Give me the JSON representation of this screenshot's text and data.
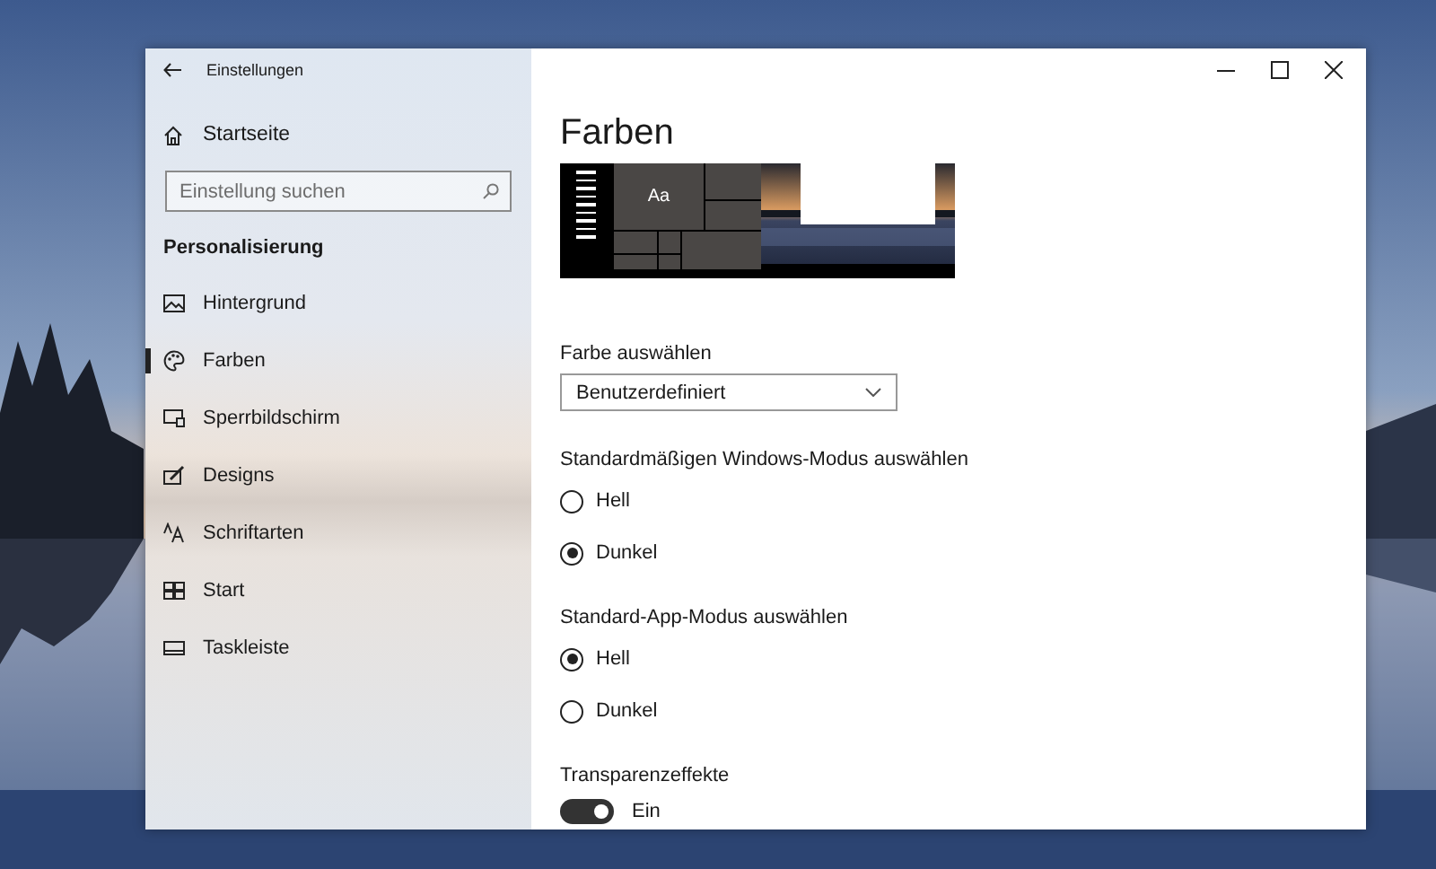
{
  "window": {
    "title": "Einstellungen"
  },
  "sidebar": {
    "home": "Startseite",
    "search": {
      "placeholder": "Einstellung suchen"
    },
    "section": "Personalisierung",
    "items": [
      {
        "label": "Hintergrund",
        "selected": false
      },
      {
        "label": "Farben",
        "selected": true
      },
      {
        "label": "Sperrbildschirm",
        "selected": false
      },
      {
        "label": "Designs",
        "selected": false
      },
      {
        "label": "Schriftarten",
        "selected": false
      },
      {
        "label": "Start",
        "selected": false
      },
      {
        "label": "Taskleiste",
        "selected": false
      }
    ]
  },
  "content": {
    "heading": "Farben",
    "preview": {
      "tile_text": "Aa"
    },
    "color_select": {
      "label": "Farbe auswählen",
      "value": "Benutzerdefiniert"
    },
    "groups": [
      {
        "label": "Standardmäßigen Windows-Modus auswählen",
        "options": [
          {
            "label": "Hell",
            "selected": false
          },
          {
            "label": "Dunkel",
            "selected": true
          }
        ]
      },
      {
        "label": "Standard-App-Modus auswählen",
        "options": [
          {
            "label": "Hell",
            "selected": true
          },
          {
            "label": "Dunkel",
            "selected": false
          }
        ]
      }
    ],
    "transparency": {
      "label": "Transparenzeffekte",
      "on": true,
      "state_text": "Ein"
    }
  }
}
